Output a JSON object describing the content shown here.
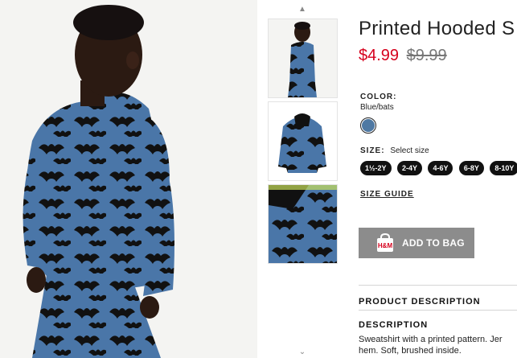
{
  "product": {
    "title": "Printed Hooded S",
    "price_current": "$4.99",
    "price_original": "$9.99"
  },
  "color": {
    "label": "COLOR:",
    "value": "Blue/bats",
    "swatch_color": "#4f79a3"
  },
  "size": {
    "label": "SIZE:",
    "hint": "Select size",
    "options": [
      "1½-2Y",
      "2-4Y",
      "4-6Y",
      "6-8Y",
      "8-10Y"
    ],
    "guide_label": "SIZE GUIDE"
  },
  "cart": {
    "add_label": "ADD TO BAG",
    "icon": "shopping-bag-icon"
  },
  "description": {
    "section_title": "PRODUCT DESCRIPTION",
    "heading": "DESCRIPTION",
    "text_line1": "Sweatshirt with a printed pattern. Jer",
    "text_line2": "hem. Soft, brushed inside."
  },
  "gallery": {
    "up_arrow": "▲",
    "down_arrow": "⌄",
    "thumbnails": [
      "thumb-front-view",
      "thumb-flat-lay",
      "thumb-detail"
    ]
  },
  "colors": {
    "price_red": "#d6001c",
    "garment_blue": "#4a76a8",
    "bat_black": "#111111",
    "button_gray": "#8c8c8c"
  }
}
